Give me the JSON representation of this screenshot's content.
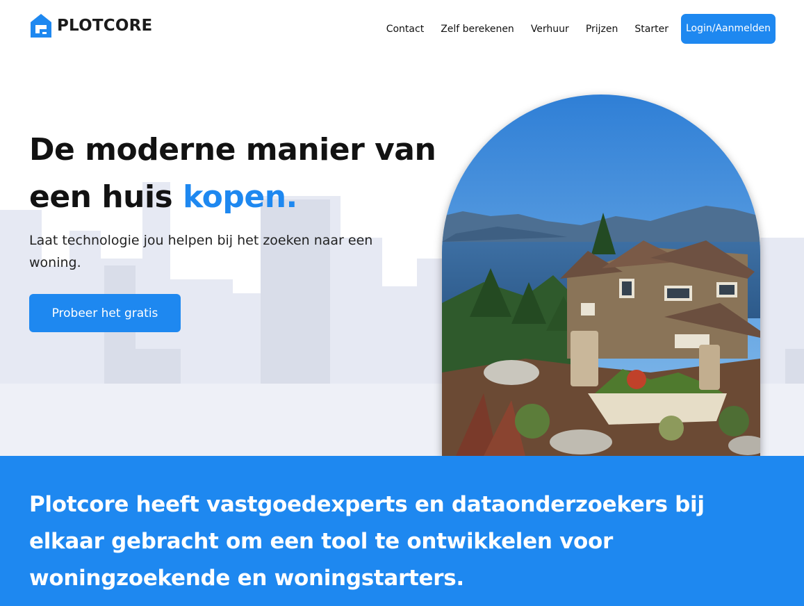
{
  "brand": {
    "name": "PLOTCORE",
    "logo_icon": "house-logo-icon",
    "accent_color": "#1e88f0"
  },
  "nav": {
    "items": [
      {
        "label": "Contact"
      },
      {
        "label": "Zelf berekenen"
      },
      {
        "label": "Verhuur"
      },
      {
        "label": "Prijzen"
      },
      {
        "label": "Starter"
      }
    ],
    "login_label": "Login/Aanmelden"
  },
  "hero": {
    "title_part1": "De moderne manier van een huis ",
    "title_accent": "kopen.",
    "subtitle": "Laat technologie jou helpen bij het zoeken naar een woning.",
    "cta_label": "Probeer het gratis",
    "image": "house-by-lake-photo"
  },
  "banner": {
    "text": "Plotcore heeft vastgoedexperts en dataonderzoekers bij elkaar gebracht om een tool te ontwikkelen voor woningzoekende en woningstarters."
  }
}
